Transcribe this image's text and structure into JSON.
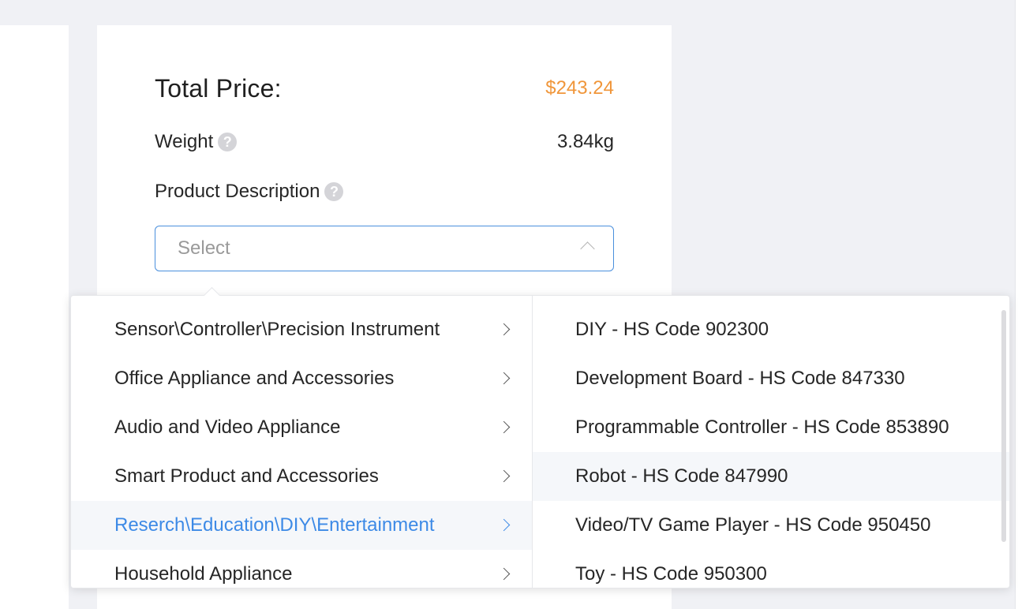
{
  "summary": {
    "total_price_label": "Total Price:",
    "total_price_value": "$243.24",
    "weight_label": "Weight",
    "weight_value": "3.84kg",
    "product_description_label": "Product Description",
    "help_glyph": "?"
  },
  "select": {
    "placeholder": "Select",
    "expanded": true
  },
  "cascader": {
    "categories": [
      {
        "label": "Sensor\\Controller\\Precision Instrument"
      },
      {
        "label": "Office Appliance and Accessories"
      },
      {
        "label": "Audio and Video Appliance"
      },
      {
        "label": "Smart Product and Accessories"
      },
      {
        "label": "Reserch\\Education\\DIY\\Entertainment"
      },
      {
        "label": "Household Appliance"
      }
    ],
    "active_category": "Reserch\\Education\\DIY\\Entertainment",
    "subcategories": [
      {
        "label": "DIY - HS Code 902300"
      },
      {
        "label": "Development Board - HS Code 847330"
      },
      {
        "label": "Programmable Controller - HS Code 853890"
      },
      {
        "label": "Robot - HS Code 847990"
      },
      {
        "label": "Video/TV Game Player - HS Code 950450"
      },
      {
        "label": "Toy - HS Code 950300"
      }
    ],
    "hovered_subcategory": "Robot - HS Code 847990"
  },
  "colors": {
    "accent_blue": "#3d8ae6",
    "price_orange": "#f0963a",
    "page_background": "#f0f1f5"
  },
  "icons": {
    "help": "question-circle-icon",
    "select_toggle": "chevron-up-icon",
    "category_expand": "chevron-right-icon"
  }
}
